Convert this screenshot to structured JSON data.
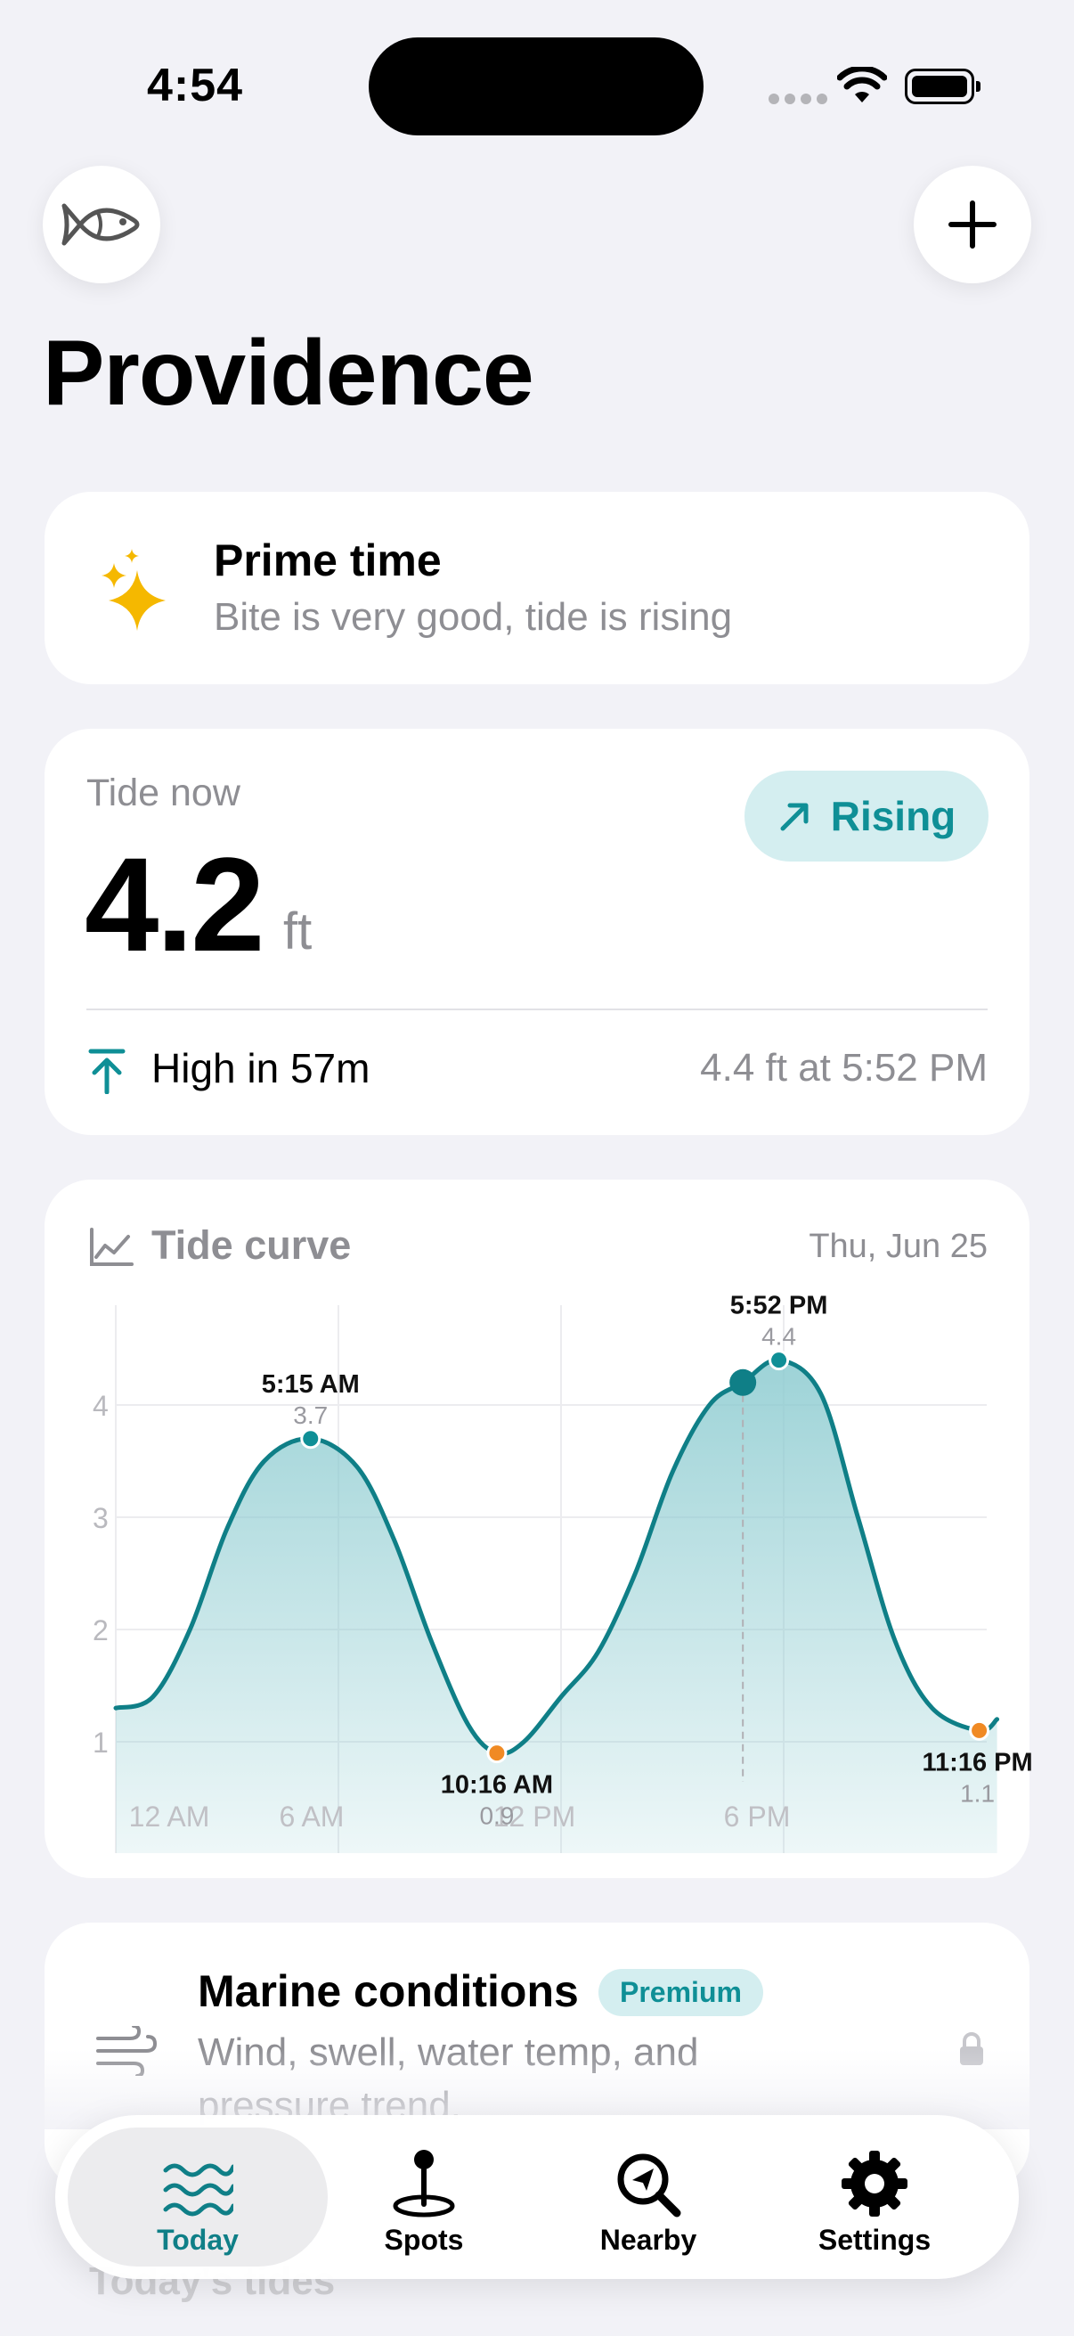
{
  "status": {
    "time": "4:54"
  },
  "header": {
    "title": "Providence"
  },
  "prime": {
    "title": "Prime time",
    "subtitle": "Bite is very good, tide is rising"
  },
  "tide": {
    "label": "Tide now",
    "value": "4.2",
    "unit": "ft",
    "trend": "Rising",
    "high_label": "High in 57m",
    "high_detail": "4.4 ft at 5:52 PM"
  },
  "tide_curve": {
    "title": "Tide curve",
    "date": "Thu, Jun 25"
  },
  "chart_data": {
    "type": "area",
    "x_unit": "hour",
    "xlim": [
      0,
      24
    ],
    "ylim": [
      0.5,
      4.8
    ],
    "y_ticks": [
      1,
      2,
      3,
      4
    ],
    "x_ticks": [
      {
        "x": 0,
        "label": "12 AM"
      },
      {
        "x": 6,
        "label": "6 AM"
      },
      {
        "x": 12,
        "label": "12 PM"
      },
      {
        "x": 18,
        "label": "6 PM"
      }
    ],
    "x": [
      0,
      1,
      2,
      3,
      4,
      5.25,
      6.5,
      7.5,
      8.5,
      9.5,
      10.27,
      11,
      12,
      13,
      14,
      15,
      16,
      16.9,
      17.87,
      19,
      20,
      21,
      22,
      23.27,
      23.75
    ],
    "y": [
      1.3,
      1.4,
      2.0,
      2.9,
      3.5,
      3.7,
      3.45,
      2.8,
      1.9,
      1.15,
      0.9,
      1.0,
      1.4,
      1.8,
      2.5,
      3.4,
      4.0,
      4.2,
      4.4,
      4.1,
      3.0,
      1.9,
      1.3,
      1.1,
      1.2
    ],
    "extremes": [
      {
        "x": 5.25,
        "y": 3.7,
        "time": "5:15 AM",
        "value": "3.7",
        "kind": "high"
      },
      {
        "x": 10.27,
        "y": 0.9,
        "time": "10:16 AM",
        "value": "0.9",
        "kind": "low"
      },
      {
        "x": 17.87,
        "y": 4.4,
        "time": "5:52 PM",
        "value": "4.4",
        "kind": "high"
      },
      {
        "x": 23.27,
        "y": 1.1,
        "time": "11:16 PM",
        "value": "1.1",
        "kind": "low"
      }
    ],
    "now": {
      "x": 16.9,
      "y": 4.2
    },
    "colors": {
      "line": "#0f7f87",
      "fill": "#8ccbd0",
      "low": "#f08a24",
      "high": "#0f8f96"
    }
  },
  "marine": {
    "title": "Marine conditions",
    "badge": "Premium",
    "subtitle": "Wind, swell, water temp, and pressure trend."
  },
  "ghost_section": "Today's tides",
  "tabs": [
    {
      "label": "Today",
      "icon": "waves-icon"
    },
    {
      "label": "Spots",
      "icon": "pin-icon"
    },
    {
      "label": "Nearby",
      "icon": "search-location-icon"
    },
    {
      "label": "Settings",
      "icon": "gear-icon"
    }
  ],
  "colors": {
    "accent": "#0f8f96",
    "background": "#f2f2f7",
    "prime_star": "#f5b800"
  }
}
